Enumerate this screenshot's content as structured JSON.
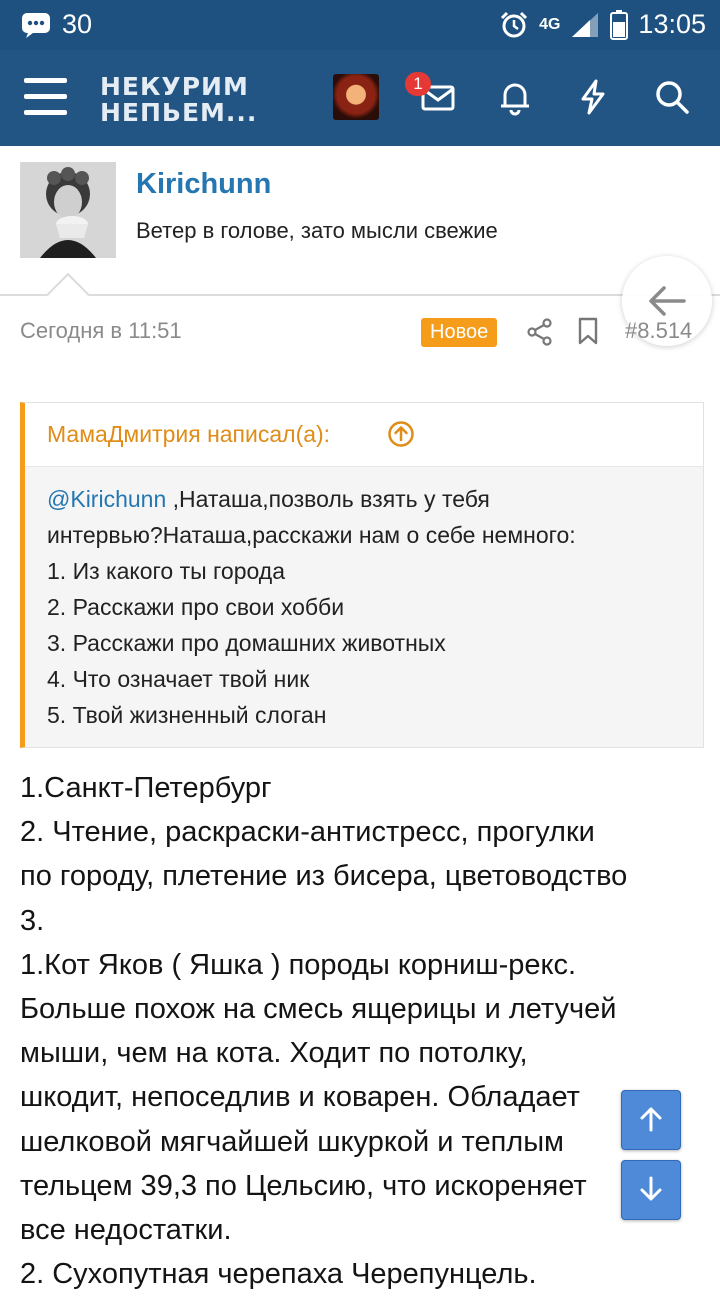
{
  "statusbar": {
    "notification_count": "30",
    "network": "4G",
    "time": "13:05"
  },
  "header": {
    "logo_line1": "НЕКУРИМ",
    "logo_line2": "НЕПЬЕМ...",
    "inbox_badge": "1",
    "icons": [
      "menu-icon",
      "avatar",
      "mail-icon",
      "bell-icon",
      "lightning-icon",
      "search-icon"
    ]
  },
  "user": {
    "name": "Kirichunn",
    "title": "Ветер в голове, зато мысли свежие"
  },
  "post": {
    "date": "Сегодня в 11:51",
    "new_label": "Новое",
    "number": "#8.514",
    "quote": {
      "author": "МамаДмитрия написал(а):",
      "mention": "@Kirichunn",
      "line1_rest": " ,Наташа,позволь взять у тебя",
      "line2": "интервью?Наташа,расскажи нам о себе немного:",
      "items": [
        "1. Из какого ты города",
        "2. Расскажи про свои хобби",
        "3. Расскажи про домашних животных",
        "4. Что означает твой ник",
        "5. Твой жизненный слоган"
      ]
    },
    "body_lines": [
      "1.Санкт-Петербург",
      "2. Чтение, раскраски-антистресс, прогулки",
      "по городу, плетение из бисера, цветоводство",
      "3.",
      "1.Кот Яков ( Яшка ) породы корниш-рекс.",
      "Больше похож на смесь ящерицы и летучей",
      "мыши, чем на кота. Ходит по потолку,",
      "шкодит, непоседлив и коварен. Обладает",
      "шелковой мягчайшей шкуркой и теплым",
      "тельцем 39,3 по Цельсию, что искореняет",
      "все недостатки.",
      "2. Сухопутная черепаха Черепунцель."
    ]
  },
  "colors": {
    "appbar": "#235584",
    "link": "#2577b1",
    "accent": "#f59c1a"
  }
}
